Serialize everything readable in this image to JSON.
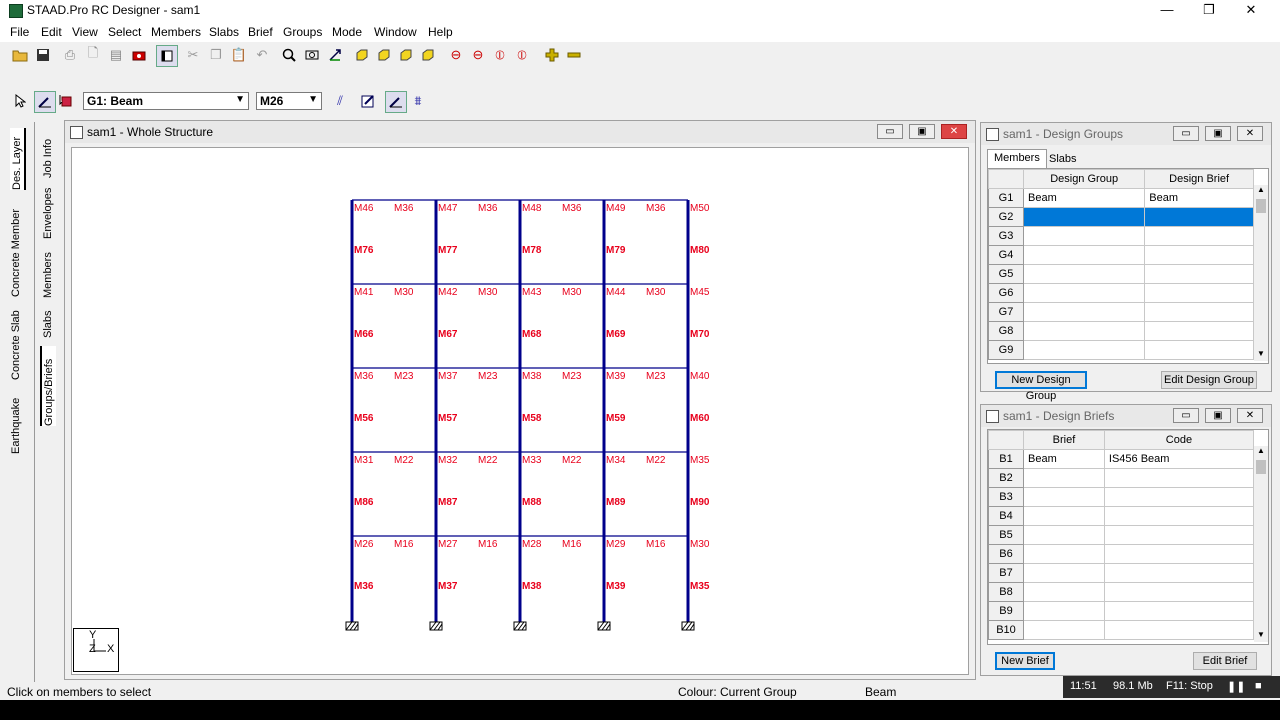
{
  "window": {
    "title": "STAAD.Pro RC Designer - sam1",
    "minimize": "—",
    "restore": "❐",
    "close": "✕"
  },
  "menu": [
    "File",
    "Edit",
    "View",
    "Select",
    "Members",
    "Slabs",
    "Brief",
    "Groups",
    "Mode",
    "Window",
    "Help"
  ],
  "toolbar": {
    "group_combo": "G1: Beam",
    "member_combo": "M26"
  },
  "left_tabs_outer": [
    "Des. Layer",
    "Concrete Member",
    "Concrete Slab",
    "Earthquake"
  ],
  "left_tabs_inner": [
    "Job Info",
    "Envelopes",
    "Members",
    "Slabs",
    "Groups/Briefs"
  ],
  "structure_window": {
    "title": "sam1 - Whole Structure",
    "columns": [
      "46",
      "47",
      "48",
      "49",
      "50"
    ],
    "rows": [
      {
        "nodes": [
          "M46",
          "M47",
          "M48",
          "M49",
          "M50"
        ],
        "beam": "M36",
        "mid": [
          "M76",
          "M77",
          "M78",
          "M79",
          "M80"
        ]
      },
      {
        "nodes": [
          "M41",
          "M42",
          "M43",
          "M44",
          "M45"
        ],
        "beam": "M30",
        "mid": [
          "M66",
          "M67",
          "M68",
          "M69",
          "M70"
        ]
      },
      {
        "nodes": [
          "M36",
          "M37",
          "M38",
          "M39",
          "M40"
        ],
        "beam": "M23",
        "mid": [
          "M56",
          "M57",
          "M58",
          "M59",
          "M60"
        ]
      },
      {
        "nodes": [
          "M31",
          "M32",
          "M33",
          "M34",
          "M35"
        ],
        "beam": "M22",
        "mid": [
          "M86",
          "M87",
          "M88",
          "M89",
          "M90"
        ]
      },
      {
        "nodes": [
          "M26",
          "M27",
          "M28",
          "M29",
          "M30"
        ],
        "beam": "M16",
        "mid": [
          "M36",
          "M37",
          "M38",
          "M39",
          "M35"
        ]
      }
    ],
    "axis": {
      "y": "Y",
      "z": "Z",
      "x": "X"
    }
  },
  "design_groups": {
    "title": "sam1 - Design Groups",
    "tabs": [
      "Members",
      "Slabs"
    ],
    "headers": [
      "Design Group",
      "Design Brief"
    ],
    "rows": [
      {
        "id": "G1",
        "group": "Beam",
        "brief": "Beam"
      },
      {
        "id": "G2",
        "group": "",
        "brief": ""
      },
      {
        "id": "G3",
        "group": "",
        "brief": ""
      },
      {
        "id": "G4",
        "group": "",
        "brief": ""
      },
      {
        "id": "G5",
        "group": "",
        "brief": ""
      },
      {
        "id": "G6",
        "group": "",
        "brief": ""
      },
      {
        "id": "G7",
        "group": "",
        "brief": ""
      },
      {
        "id": "G8",
        "group": "",
        "brief": ""
      },
      {
        "id": "G9",
        "group": "",
        "brief": ""
      }
    ],
    "new_button": "New Design Group",
    "edit_button": "Edit Design Group"
  },
  "design_briefs": {
    "title": "sam1 - Design Briefs",
    "headers": [
      "Brief",
      "Code"
    ],
    "rows": [
      {
        "id": "B1",
        "brief": "Beam",
        "code": "IS456 Beam"
      },
      {
        "id": "B2",
        "brief": "",
        "code": ""
      },
      {
        "id": "B3",
        "brief": "",
        "code": ""
      },
      {
        "id": "B4",
        "brief": "",
        "code": ""
      },
      {
        "id": "B5",
        "brief": "",
        "code": ""
      },
      {
        "id": "B6",
        "brief": "",
        "code": ""
      },
      {
        "id": "B7",
        "brief": "",
        "code": ""
      },
      {
        "id": "B8",
        "brief": "",
        "code": ""
      },
      {
        "id": "B9",
        "brief": "",
        "code": ""
      },
      {
        "id": "B10",
        "brief": "",
        "code": ""
      }
    ],
    "new_button": "New Brief",
    "edit_button": "Edit Brief"
  },
  "status": {
    "hint": "Click on members to select",
    "colour": "Colour: Current Group",
    "type": "Beam"
  },
  "tray": {
    "time": "11:51",
    "memory": "98.1 Mb",
    "stop": "F11: Stop",
    "pause": "❚❚",
    "recorder": "■"
  },
  "colors": {
    "frame": "#00008b",
    "labels": "#e8001c",
    "selection": "#0078d7"
  }
}
